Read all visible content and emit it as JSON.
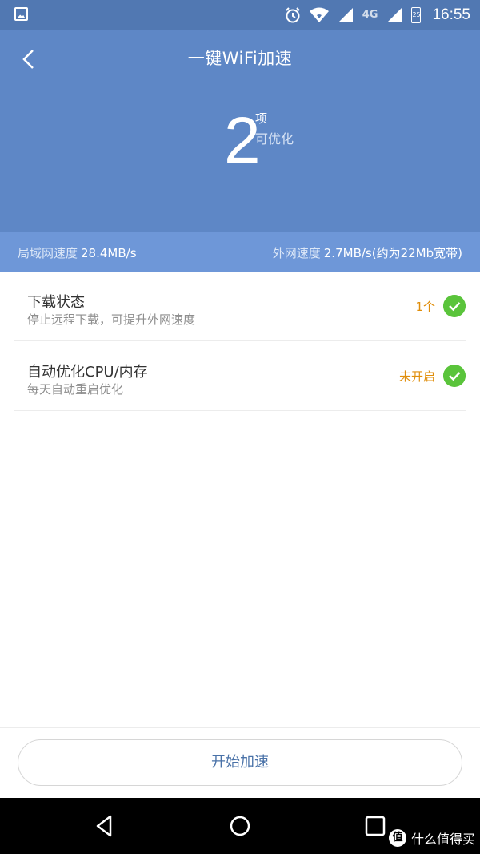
{
  "status_bar": {
    "network": "4G",
    "battery": "25",
    "time": "16:55"
  },
  "header": {
    "title": "一键WiFi加速",
    "count": "2",
    "count_unit": "项",
    "count_desc": "可优化"
  },
  "speed": {
    "lan_label": "局域网速度",
    "lan_value": "28.4MB/s",
    "wan_label": "外网速度",
    "wan_value": "2.7MB/s",
    "wan_note": "(约为22Mb宽带)"
  },
  "items": [
    {
      "title": "下载状态",
      "subtitle": "停止远程下载，可提升外网速度",
      "status": "1个"
    },
    {
      "title": "自动优化CPU/内存",
      "subtitle": "每天自动重启优化",
      "status": "未开启"
    }
  ],
  "action": {
    "start_label": "开始加速"
  },
  "watermark": {
    "text": "什么值得买",
    "icon": "值"
  },
  "colors": {
    "header": "#5e87c6",
    "speedbar": "#6e97d8",
    "status": "#e08e0b",
    "check": "#5ac43b"
  }
}
